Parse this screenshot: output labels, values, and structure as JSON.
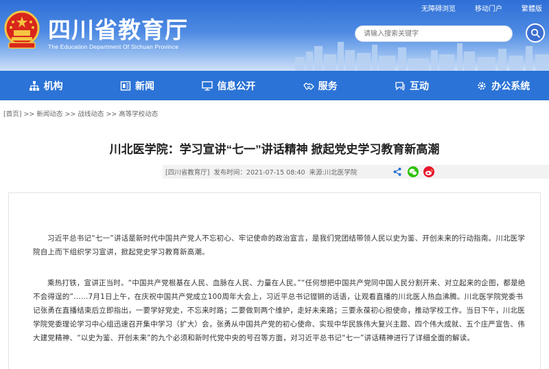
{
  "header": {
    "title": "四川省教育厅",
    "subtitle": "The Education Department Of Sichuan Province",
    "top_links": [
      "无障碍浏览",
      "移动门户",
      "繁體版"
    ],
    "search_placeholder": "请输入搜索关键字"
  },
  "nav": {
    "items": [
      {
        "label": "机构",
        "icon": "org-icon"
      },
      {
        "label": "新闻",
        "icon": "news-icon"
      },
      {
        "label": "信息公开",
        "icon": "monitor-icon"
      },
      {
        "label": "服务",
        "icon": "handshake-icon"
      },
      {
        "label": "互动",
        "icon": "chat-icon"
      },
      {
        "label": "办公系统",
        "icon": "gear-icon"
      }
    ]
  },
  "breadcrumb": "[首页] >> 新闻动态 >> 战线动态 >> 高等学校动态",
  "article": {
    "title": "川北医学院：学习宣讲“七一”讲话精神 掀起党史学习教育新高潮",
    "meta_source_tag": "[四川省教育厅]",
    "meta_time": "发布时间：2021-07-15 08:40",
    "meta_source": "来源:川北医学院",
    "para1": "习近平总书记“七一”讲话是新时代中国共产党人不忘初心、牢记使命的政治宣言，是我们党团结带领人民以史为鉴、开创未来的行动指南。川北医学院自上而下组织学习宣讲，掀起党史学习教育新高潮。",
    "para2": "乘热打铁，宣讲正当时。“中国共产党根基在人民、血脉在人民、力量在人民。”“任何想把中国共产党同中国人民分割开来、对立起来的企图，都是绝不会得逞的”……7月1日上午，在庆祝中国共产党成立100周年大会上，习近平总书记铿锵的话语，让观看直播的川北医人热血沸腾。川北医学院党委书记张勇在直播结束后立即指出，一要学好党史，不忘来时路；二要做到两个维护，走好未来路；三要永葆初心担使命，推动学校工作。当日下午，川北医学院党委理论学习中心组迅速召开集中学习（扩大）会，张勇从中国共产党的初心使命、实现中华民族伟大复兴主题、四个伟大成就、五个庄严宣告、伟大建党精神、“以史为鉴、开创未来”的九个必须和新时代党中央的号召等方面，对习近平总书记“七一”讲话精神进行了详细全面的解读。"
  },
  "colors": {
    "header_blue": "#2f6fd6",
    "nav_blue": "#2b73d6",
    "wechat_green": "#2dc100",
    "weibo_red": "#e6162d",
    "share_blue": "#2b73d6"
  }
}
